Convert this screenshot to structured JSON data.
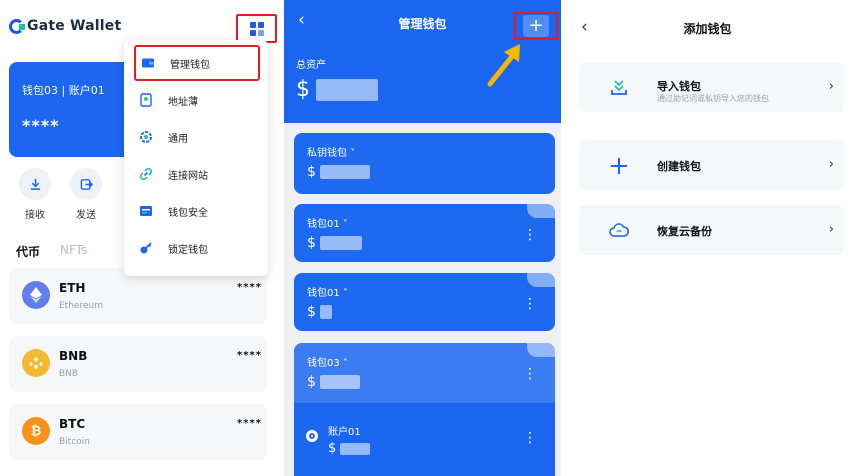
{
  "colors": {
    "accent": "#1b66f0",
    "highlight": "#e02020",
    "pointer_arrow": "#f5b800"
  },
  "panel1": {
    "brand": "Gate Wallet",
    "wallet_card": {
      "title": "钱包03 | 账户01",
      "balance_masked": "****"
    },
    "actions": [
      {
        "label": "接收",
        "icon": "download-icon"
      },
      {
        "label": "发送",
        "icon": "send-icon"
      }
    ],
    "tabs": {
      "active": "代币",
      "other": "NFTs"
    },
    "tokens": [
      {
        "symbol": "ETH",
        "name": "Ethereum",
        "balance": "****",
        "color": "#627eea",
        "icon": "eth-icon"
      },
      {
        "symbol": "BNB",
        "name": "BNB",
        "balance": "****",
        "color": "#f3ba2f",
        "icon": "bnb-icon"
      },
      {
        "symbol": "BTC",
        "name": "Bitcoin",
        "balance": "****",
        "color": "#f7931a",
        "icon": "btc-icon"
      }
    ],
    "menu": {
      "items": [
        {
          "label": "管理钱包",
          "icon": "wallet-icon"
        },
        {
          "label": "地址薄",
          "icon": "address-book-icon"
        },
        {
          "label": "通用",
          "icon": "settings-icon"
        },
        {
          "label": "连接网站",
          "icon": "link-icon"
        },
        {
          "label": "钱包安全",
          "icon": "security-icon"
        },
        {
          "label": "锁定钱包",
          "icon": "lock-icon"
        }
      ]
    }
  },
  "panel2": {
    "title": "管理钱包",
    "add_symbol": "+",
    "back_symbol": "‹",
    "total_label": "总资产",
    "currency": "$",
    "wallets": [
      {
        "name": "私钥钱包",
        "chevron": "˅"
      },
      {
        "name": "钱包01",
        "chevron": "˅"
      },
      {
        "name": "钱包01",
        "chevron": "˅"
      },
      {
        "name": "钱包03",
        "chevron": "˄"
      }
    ],
    "account": {
      "name": "账户01"
    }
  },
  "panel3": {
    "title": "添加钱包",
    "back_symbol": "‹",
    "options": [
      {
        "label": "导入钱包",
        "sub": "通过助记词或私钥导入您的钱包",
        "icon": "import-icon"
      },
      {
        "label": "创建钱包",
        "sub": "",
        "icon": "plus-icon"
      },
      {
        "label": "恢复云备份",
        "sub": "",
        "icon": "cloud-restore-icon"
      }
    ],
    "chevron": "›"
  }
}
